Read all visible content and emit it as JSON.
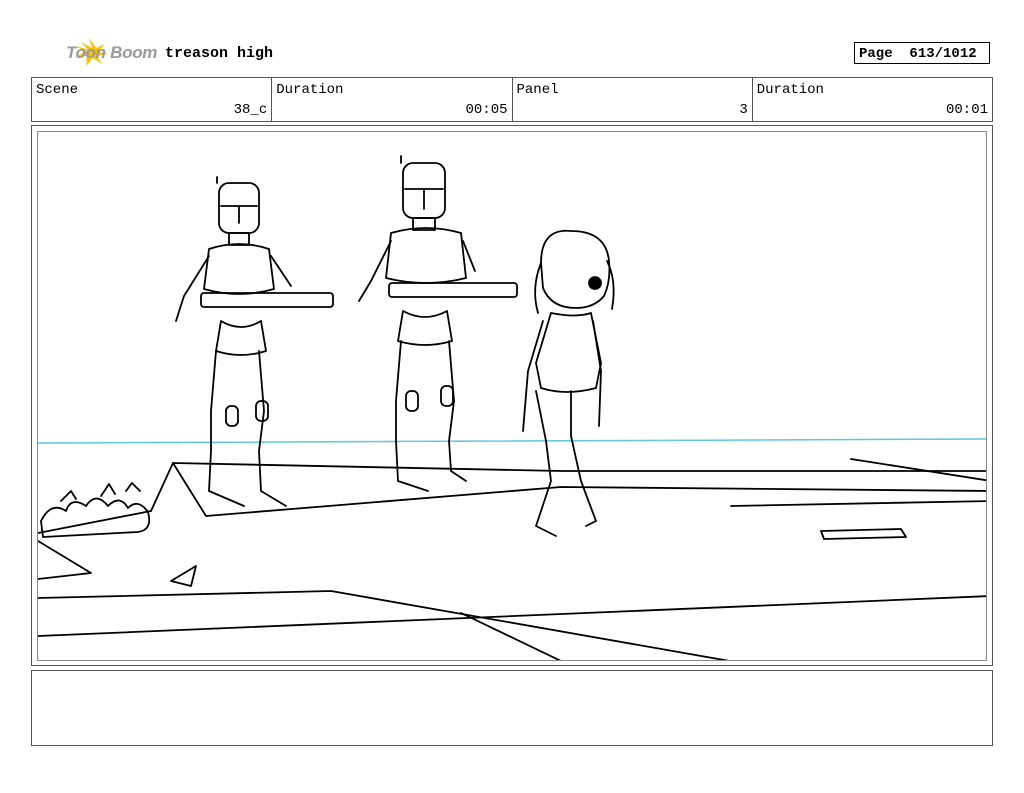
{
  "header": {
    "logo_text": "Toon Boom",
    "project_title": "treason high",
    "page_label": "Page",
    "page_value": "613/1012"
  },
  "info": {
    "scene_label": "Scene",
    "scene_value": "38_c",
    "duration_label": "Duration",
    "duration_value": "00:05",
    "panel_label": "Panel",
    "panel_value": "3",
    "panel_duration_label": "Duration",
    "panel_duration_value": "00:01"
  },
  "notes": {
    "text": ""
  },
  "colors": {
    "horizon_line": "#5cc8d8",
    "logo_yellow": "#f5c400",
    "logo_gray": "#9a9a9a"
  }
}
